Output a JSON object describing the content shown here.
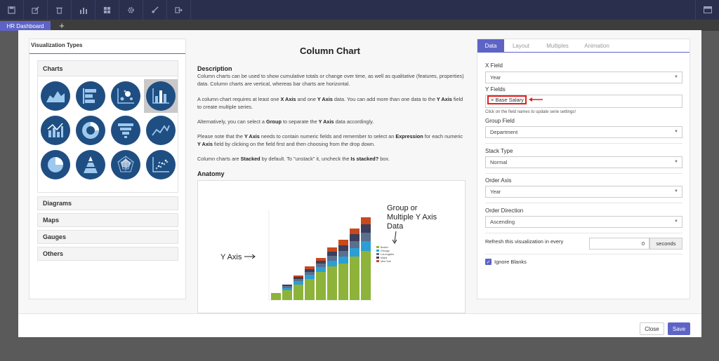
{
  "toolbar": {
    "icons": [
      "save-icon",
      "edit-icon",
      "trash-icon",
      "bar-chart-icon",
      "grid-icon",
      "gear-icon",
      "brush-icon",
      "export-icon"
    ],
    "right_icon": "panel-icon"
  },
  "tabs": {
    "active": "HR Dashboard",
    "add": "+"
  },
  "left": {
    "title": "Visualization Types",
    "sections": [
      "Charts",
      "Diagrams",
      "Maps",
      "Gauges",
      "Others"
    ]
  },
  "center": {
    "title": "Column Chart",
    "description_heading": "Description",
    "anatomy_heading": "Anatomy",
    "anatomy": {
      "y_axis_label": "Y Axis",
      "group_label_1": "Group or",
      "group_label_2": "Multiple Y Axis",
      "group_label_3": "Data",
      "legend": [
        "Boston",
        "Chicago",
        "Los Angeles",
        "Miami",
        "New York"
      ],
      "legend_colors": [
        "#8db33a",
        "#2a9fd6",
        "#5b6f8f",
        "#3d3d5c",
        "#c8491b"
      ]
    }
  },
  "right": {
    "tabs": [
      "Data",
      "Layout",
      "Multiples",
      "Animation"
    ],
    "x_field_label": "X Field",
    "x_field_value": "Year",
    "y_fields_label": "Y Fields",
    "y_field_chip": "× Base Salary",
    "hint": "Click on the field names to update serie settings!",
    "group_field_label": "Group Field",
    "group_field_value": "Department",
    "stack_type_label": "Stack Type",
    "stack_type_value": "Normal",
    "order_axis_label": "Order Axis",
    "order_axis_value": "Year",
    "order_direction_label": "Order Direction",
    "order_direction_value": "Ascending",
    "refresh_label": "Refresh this visualization in every",
    "refresh_value": "0",
    "refresh_unit": "seconds",
    "ignore_blanks_label": "Ignore Blanks",
    "ignore_blanks_checked": true
  },
  "footer": {
    "close_label": "Close",
    "save_label": "Save"
  },
  "colors": {
    "accent": "#5e64c6",
    "icon_circle": "#1f4e82",
    "highlight": "#e02020"
  }
}
